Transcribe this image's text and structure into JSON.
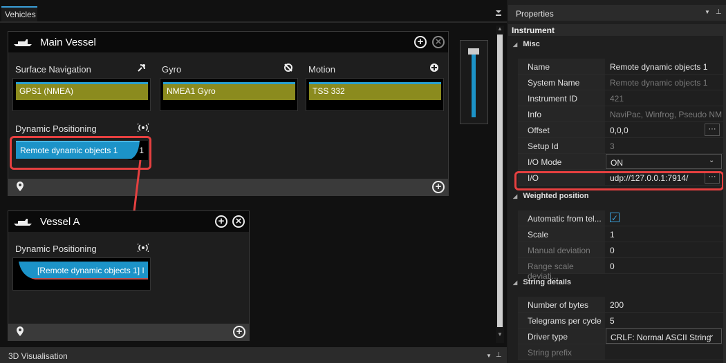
{
  "vehicles": {
    "tab_label": "Vehicles",
    "main_vessel": {
      "title": "Main Vessel",
      "slots": [
        {
          "label": "Surface Navigation",
          "icon": "satellite-icon",
          "value": "GPS1 (NMEA)"
        },
        {
          "label": "Gyro",
          "icon": "gyro-icon",
          "value": "NMEA1 Gyro"
        },
        {
          "label": "Motion",
          "icon": "motion-icon",
          "value": "TSS 332"
        }
      ],
      "dp_label": "Dynamic Positioning",
      "dp_value": "Remote dynamic objects 1",
      "dp_count": "1"
    },
    "vessel_a": {
      "title": "Vessel A",
      "dp_label": "Dynamic Positioning",
      "dp_value": "[Remote dynamic objects 1] I"
    }
  },
  "bottom_panel": {
    "title": "3D Visualisation"
  },
  "properties": {
    "title": "Properties",
    "category": "Instrument",
    "groups": [
      {
        "name": "Misc",
        "rows": [
          {
            "name": "Name",
            "value": "Remote dynamic objects 1"
          },
          {
            "name": "System Name",
            "value": "Remote dynamic objects 1",
            "dim_value": true
          },
          {
            "name": "Instrument ID",
            "value": "421",
            "dim_value": true
          },
          {
            "name": "Info",
            "value": "NaviPac, Winfrog, Pseudo NMEA",
            "dim_value": true
          },
          {
            "name": "Offset",
            "value": "0,0,0"
          },
          {
            "name": "Setup Id",
            "value": "3",
            "dim_value": true
          },
          {
            "name": "I/O Mode",
            "value": "ON"
          },
          {
            "name": "I/O",
            "value": "udp://127.0.0.1:7914/"
          }
        ]
      },
      {
        "name": "Weighted position",
        "rows": [
          {
            "name": "Automatic from tel...",
            "value": "✓"
          },
          {
            "name": "Scale",
            "value": "1"
          },
          {
            "name": "Manual deviation",
            "value": "0",
            "dim_name": true
          },
          {
            "name": "Range scale deviati...",
            "value": "0",
            "dim_name": true
          }
        ]
      },
      {
        "name": "String details",
        "rows": [
          {
            "name": "Number of bytes",
            "value": "200"
          },
          {
            "name": "Telegrams per cycle",
            "value": "5"
          },
          {
            "name": "Driver type",
            "value": "CRLF:    Normal ASCII String"
          },
          {
            "name": "String prefix",
            "value": "",
            "dim_name": true
          }
        ]
      }
    ]
  },
  "colors": {
    "accent": "#2aa0d0",
    "highlight": "#e64040",
    "output": "#8b8b1e"
  }
}
